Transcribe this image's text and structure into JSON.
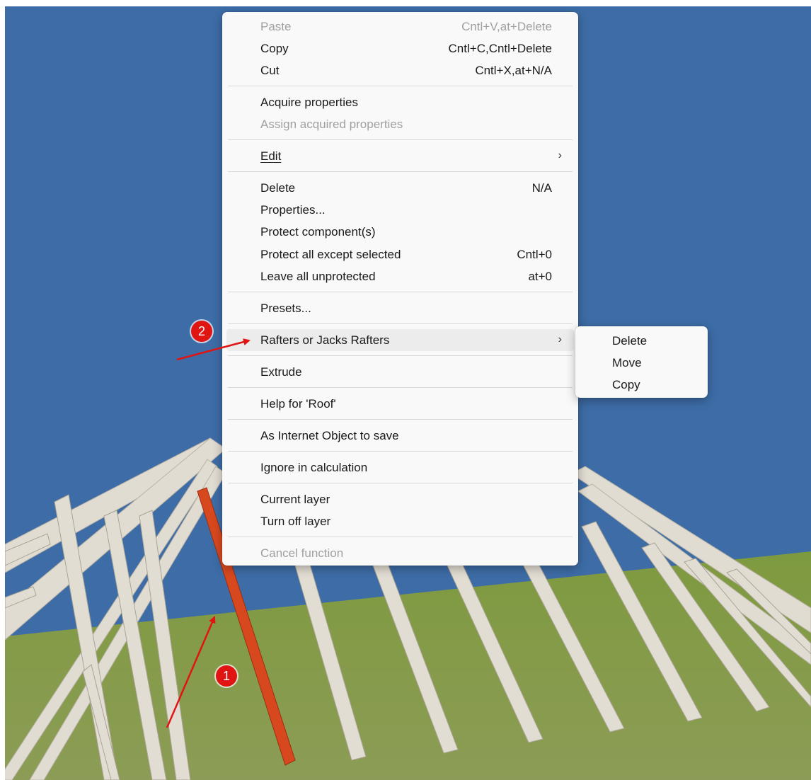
{
  "colors": {
    "sky": "#3d6ca6",
    "ground": "#7f9a44",
    "rafter": "#e2ddd3",
    "selected_rafter": "#d8481f",
    "menu_bg": "#f9f9f9",
    "annotation": "#e11414"
  },
  "context_menu": {
    "paste": {
      "label": "Paste",
      "accel": "Cntl+V,at+Delete",
      "disabled": true
    },
    "copy": {
      "label": "Copy",
      "accel": "Cntl+C,Cntl+Delete"
    },
    "cut": {
      "label": "Cut",
      "accel": "Cntl+X,at+N/A"
    },
    "acquire": {
      "label": "Acquire properties"
    },
    "assign": {
      "label": "Assign acquired properties",
      "disabled": true
    },
    "edit": {
      "label": "Edit",
      "has_submenu": true
    },
    "delete": {
      "label": "Delete",
      "accel": "N/A"
    },
    "properties": {
      "label": "Properties..."
    },
    "protect": {
      "label": "Protect component(s)"
    },
    "protect_except": {
      "label": "Protect all except selected",
      "accel": "Cntl+0"
    },
    "leave_unprotected": {
      "label": "Leave all unprotected",
      "accel": "at+0"
    },
    "presets": {
      "label": "Presets..."
    },
    "rafters": {
      "label": "Rafters or Jacks Rafters",
      "has_submenu": true,
      "highlighted": true
    },
    "extrude": {
      "label": "Extrude"
    },
    "help": {
      "label": "Help for 'Roof'"
    },
    "internet_object": {
      "label": "As Internet Object to save"
    },
    "ignore": {
      "label": "Ignore in calculation"
    },
    "current_layer": {
      "label": "Current layer"
    },
    "turn_off_layer": {
      "label": "Turn off layer"
    },
    "cancel": {
      "label": "Cancel function",
      "disabled": true
    }
  },
  "submenu": {
    "delete": "Delete",
    "move": "Move",
    "copy": "Copy"
  },
  "icons": {
    "submenu_arrow": "chevron-right-icon"
  },
  "annotations": {
    "badge_1": "1",
    "badge_2": "2"
  }
}
